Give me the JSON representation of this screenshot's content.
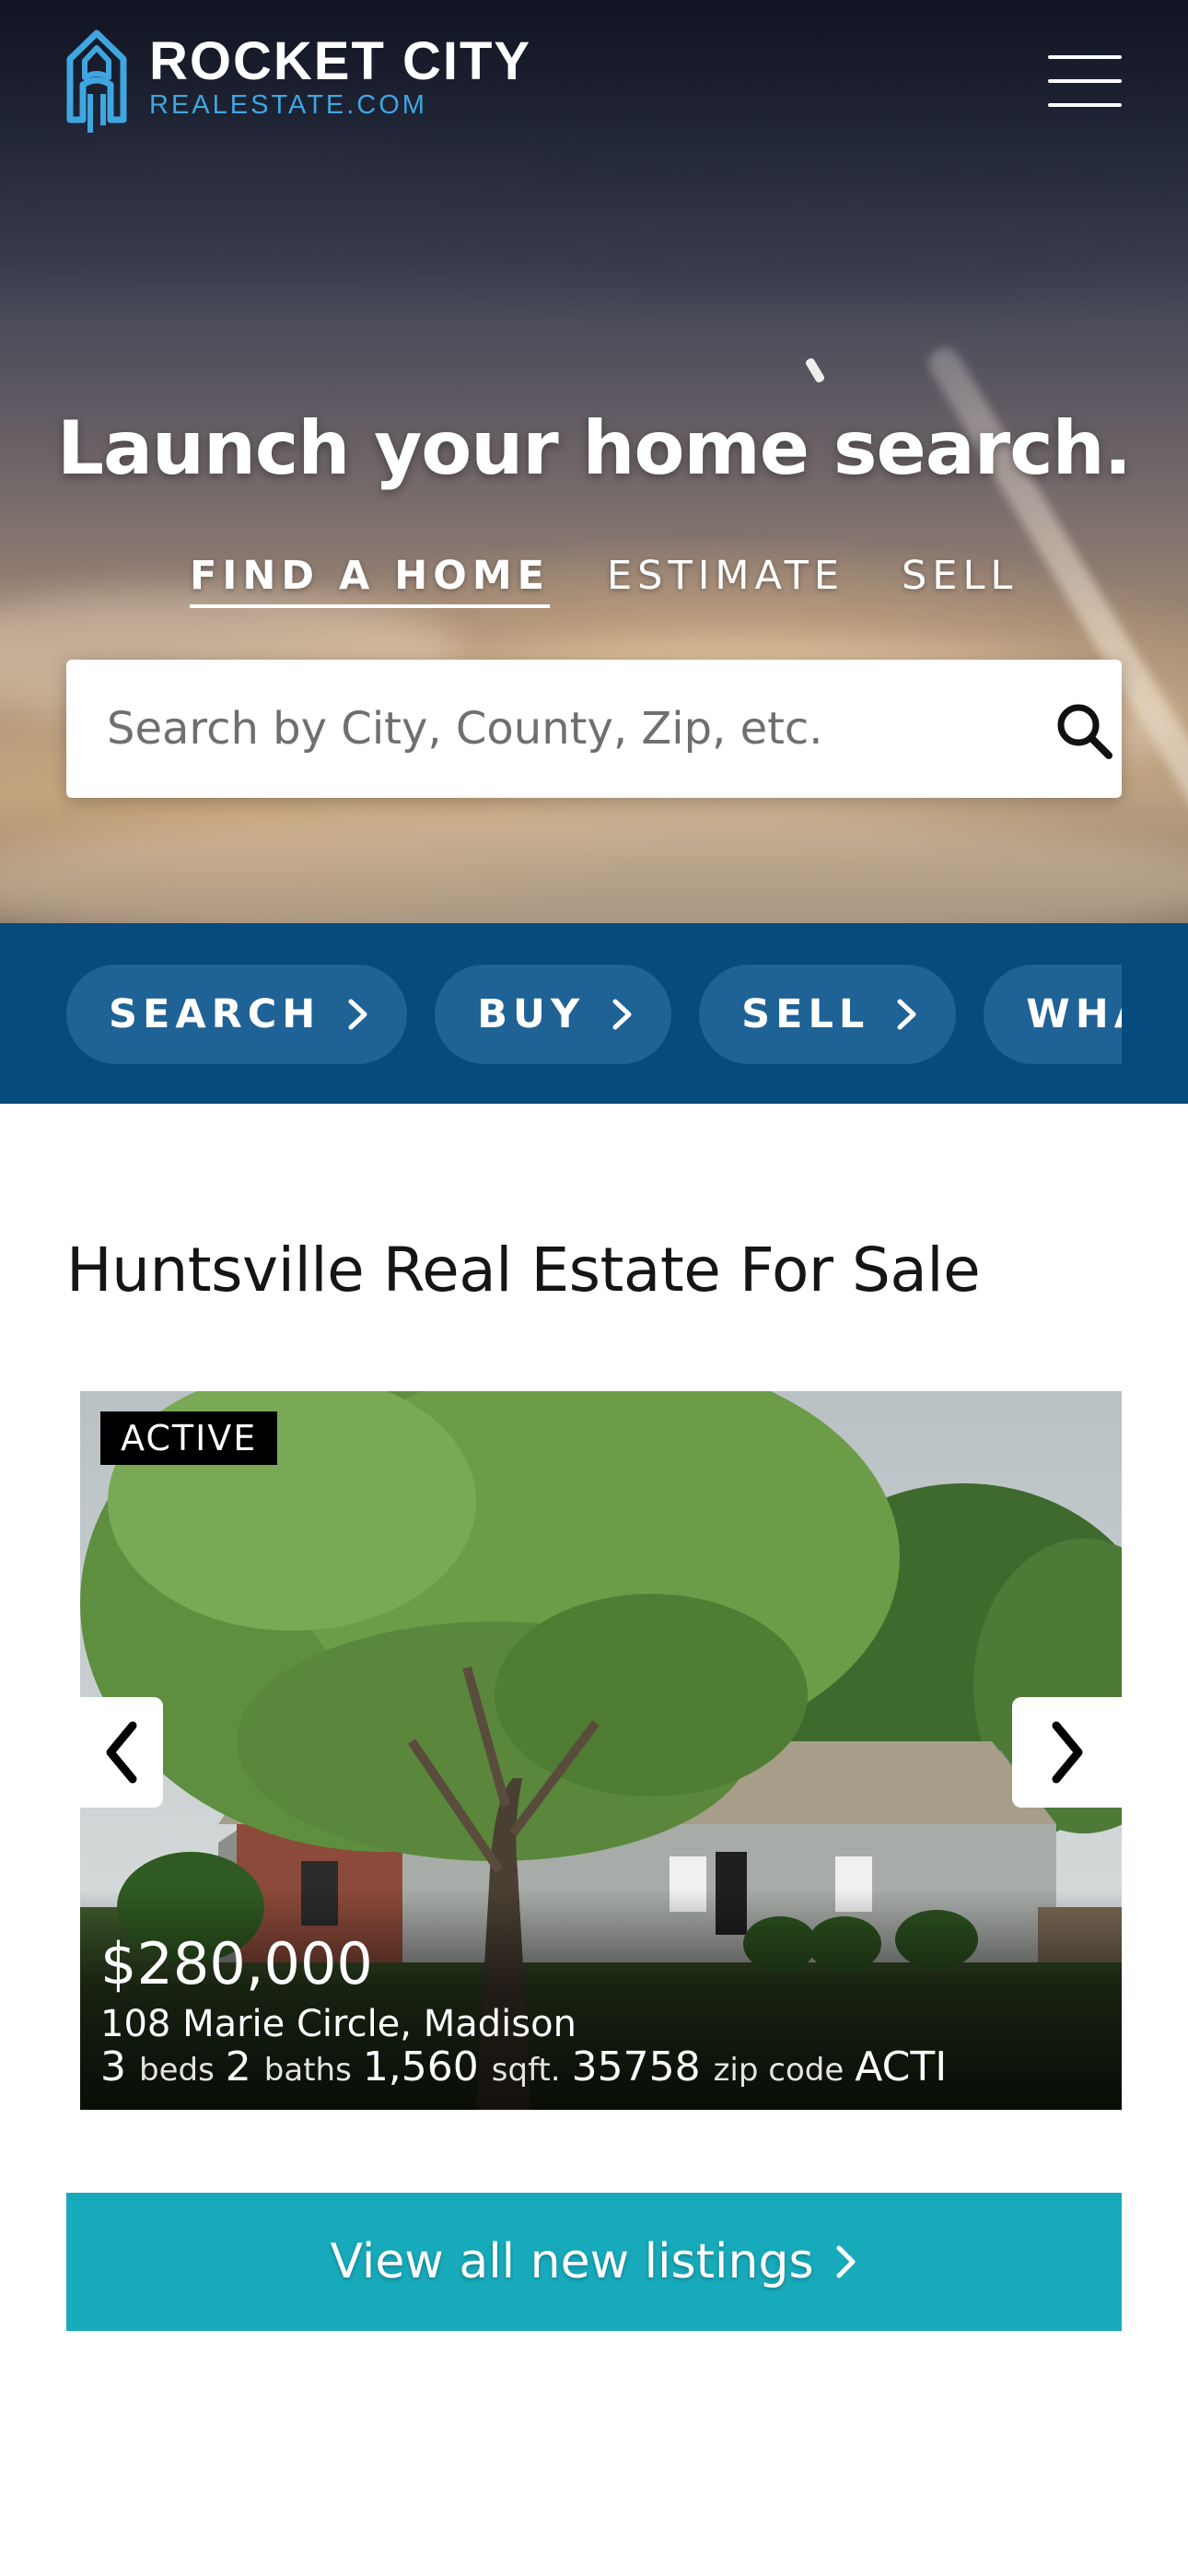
{
  "header": {
    "logo_title": "ROCKET CITY",
    "logo_subtitle": "REALESTATE.COM",
    "logo_icon": "rocket-house-icon",
    "menu_icon": "hamburger-menu-icon"
  },
  "hero": {
    "headline": "Launch your home search.",
    "tabs": [
      {
        "label": "FIND A HOME",
        "active": true
      },
      {
        "label": "ESTIMATE",
        "active": false
      },
      {
        "label": "SELL",
        "active": false
      }
    ],
    "search": {
      "placeholder": "Search by City, County, Zip, etc.",
      "value": "",
      "icon": "search-icon"
    }
  },
  "quick_links": [
    {
      "label": "SEARCH",
      "icon": "chevron-right-icon"
    },
    {
      "label": "BUY",
      "icon": "chevron-right-icon"
    },
    {
      "label": "SELL",
      "icon": "chevron-right-icon"
    },
    {
      "label": "WHA",
      "icon": "chevron-right-icon"
    }
  ],
  "listings_section": {
    "title": "Huntsville Real Estate For Sale",
    "listing": {
      "status": "ACTIVE",
      "price": "$280,000",
      "address": "108 Marie Circle, Madison",
      "beds": "3",
      "beds_label": "beds",
      "baths": "2",
      "baths_label": "baths",
      "sqft": "1,560",
      "sqft_label": "sqft.",
      "zip": "35758",
      "zip_label": "zip code",
      "status_tail": "ACTI"
    },
    "cta_label": "View all new listings"
  },
  "colors": {
    "brand_blue": "#054b7e",
    "chip_blue": "#1f6296",
    "logo_accent": "#3fa6e0",
    "cta_teal": "#17aabb"
  }
}
